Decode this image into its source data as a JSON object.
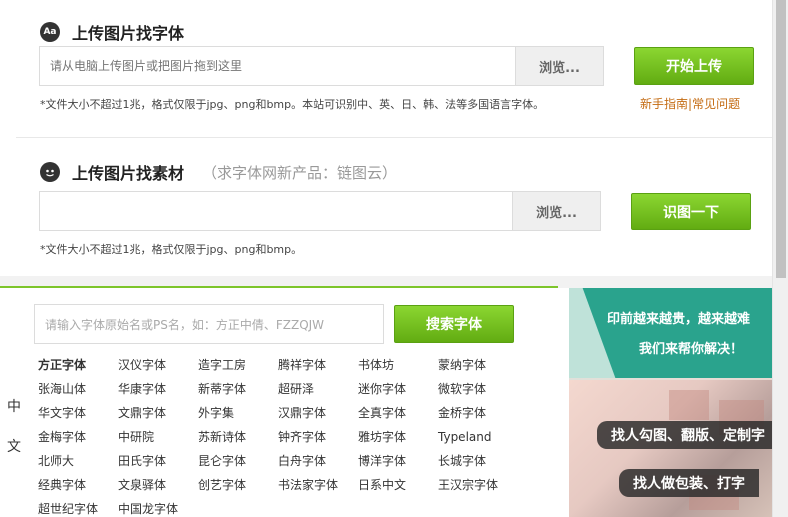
{
  "section1": {
    "icon": "Aa",
    "title": "上传图片找字体",
    "placeholder": "请从电脑上传图片或把图片拖到这里",
    "browse_label": "浏览...",
    "upload_label": "开始上传",
    "note": "*文件大小不超过1兆，格式仅限于jpg、png和bmp。本站可识别中、英、日、韩、法等多国语言字体。",
    "link_guide": "新手指南",
    "link_sep": "|",
    "link_faq": "常见问题"
  },
  "section2": {
    "title": "上传图片找素材",
    "subtitle": "（求字体网新产品：链图云）",
    "browse_label": "浏览...",
    "identify_label": "识图一下",
    "note": "*文件大小不超过1兆，格式仅限于jpg、png和bmp。"
  },
  "search": {
    "placeholder": "请输入字体原始名或PS名，如：方正中倩、FZZQJW",
    "button_label": "搜索字体"
  },
  "side_label": {
    "top": "中",
    "bottom": "文"
  },
  "fonts": [
    "方正字体",
    "汉仪字体",
    "造字工房",
    "腾祥字体",
    "书体坊",
    "蒙纳字体",
    "张海山体",
    "华康字体",
    "新蒂字体",
    "超研泽",
    "迷你字体",
    "微软字体",
    "华文字体",
    "文鼎字体",
    "外字集",
    "汉鼎字体",
    "全真字体",
    "金桥字体",
    "金梅字体",
    "中研院",
    "苏新诗体",
    "钟齐字体",
    "雅坊字体",
    "Typeland",
    "北师大",
    "田氏字体",
    "昆仑字体",
    "白舟字体",
    "博洋字体",
    "长城字体",
    "经典字体",
    "文泉驿体",
    "创艺字体",
    "书法家字体",
    "日系中文",
    "王汉宗字体",
    "超世纪字体",
    "中国龙字体"
  ],
  "ad": {
    "line1": "印前越来越贵，越来越难",
    "line2": "我们来帮你解决！",
    "tag1": "找人勾图、翻版、定制字",
    "tag2": "找人做包装、打字"
  },
  "colors": {
    "green": "#7dc52b",
    "link": "#c46b12",
    "teal": "#2aa38d"
  }
}
